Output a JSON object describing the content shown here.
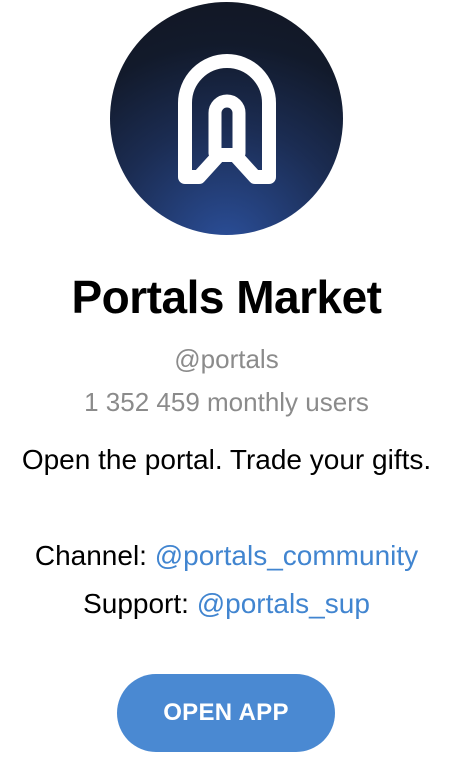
{
  "bot": {
    "name": "Portals Market",
    "username": "@portals",
    "monthly_users": "1 352 459 monthly users",
    "description": "Open the portal. Trade your gifts.",
    "avatar_icon": "portal-arch-icon"
  },
  "links": {
    "channel_label": "Channel: ",
    "channel_handle": "@portals_community",
    "support_label": "Support: ",
    "support_handle": "@portals_sup"
  },
  "actions": {
    "open_app_label": "OPEN APP"
  },
  "colors": {
    "link": "#4185d0",
    "button": "#4a89d2",
    "muted_text": "#8b8b8b",
    "avatar_dark": "#121a2b",
    "avatar_blue": "#2b4f9a"
  }
}
